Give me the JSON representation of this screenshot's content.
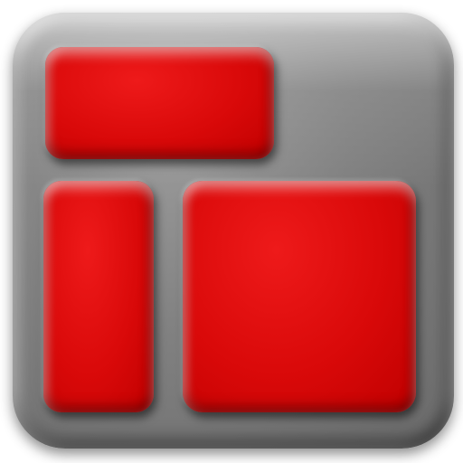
{
  "icon": {
    "name": "layout-grid-icon",
    "frame_color": "#808080",
    "tile_color": "#d90909"
  },
  "tiles": [
    {
      "role": "header-block"
    },
    {
      "role": "sidebar-block"
    },
    {
      "role": "content-block"
    }
  ]
}
